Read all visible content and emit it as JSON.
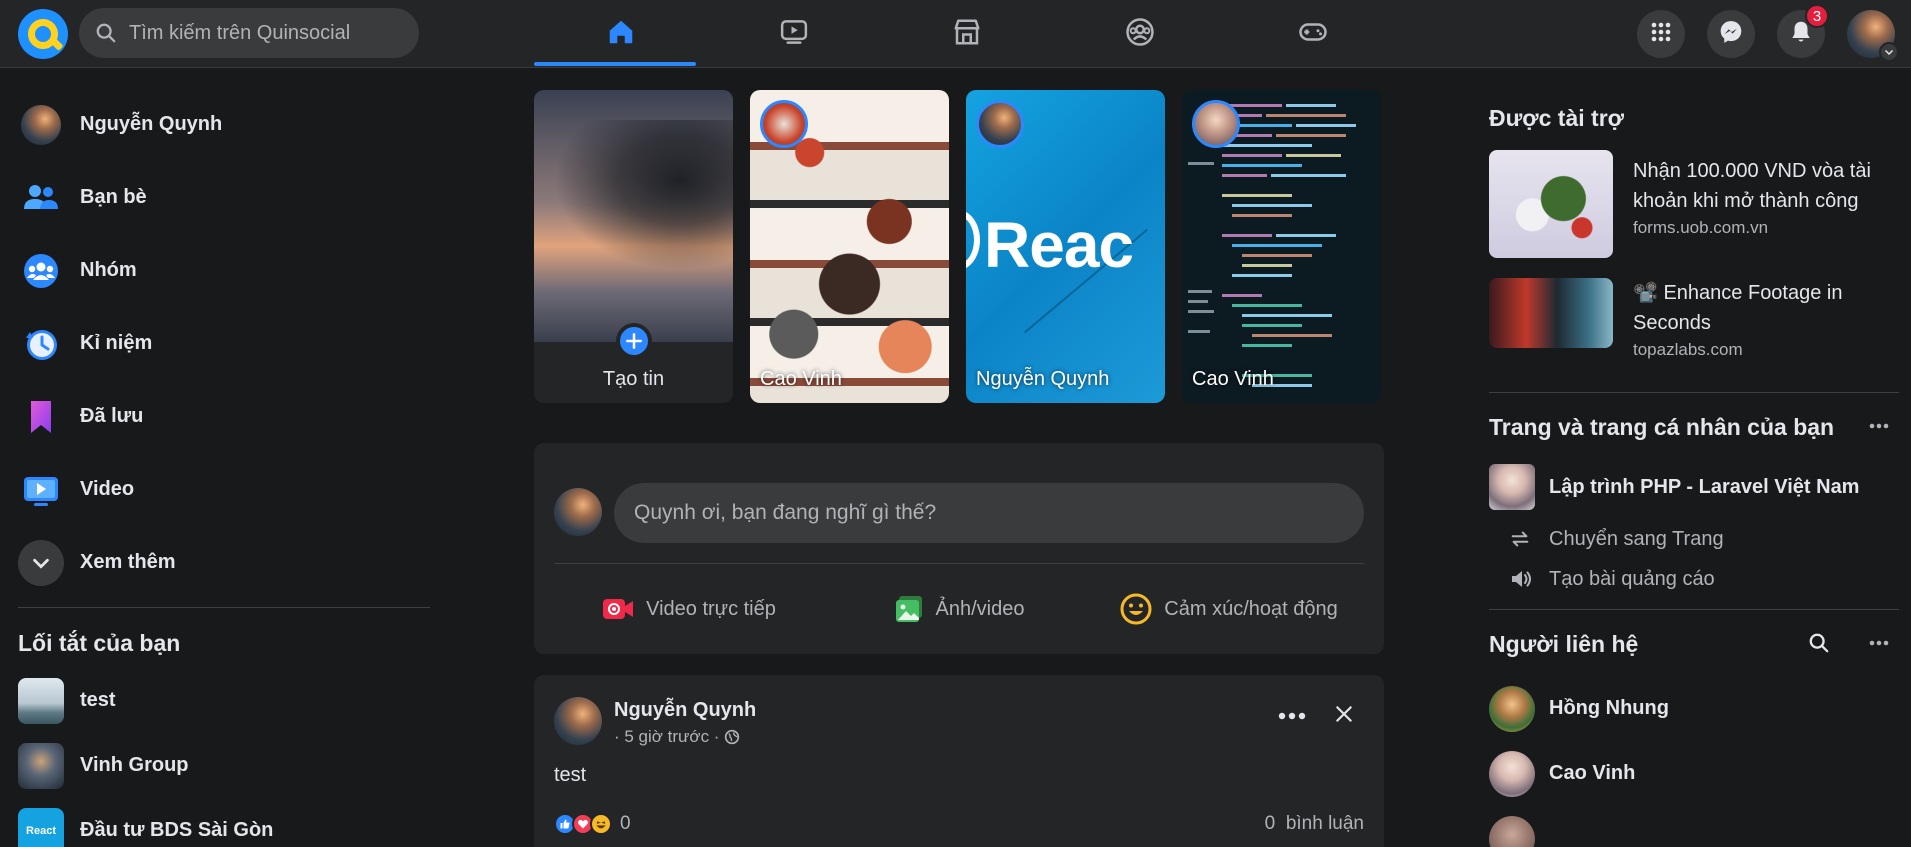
{
  "header": {
    "search_placeholder": "Tìm kiếm trên Quinsocial",
    "notification_count": "3",
    "nav_tabs": [
      "home",
      "watch",
      "marketplace",
      "groups",
      "gaming"
    ]
  },
  "left": {
    "profile_name": "Nguyễn Quynh",
    "items": [
      {
        "label": "Bạn bè",
        "icon": "friends-icon"
      },
      {
        "label": "Nhóm",
        "icon": "groups-icon"
      },
      {
        "label": "Kỉ niệm",
        "icon": "memories-icon"
      },
      {
        "label": "Đã lưu",
        "icon": "saved-icon"
      },
      {
        "label": "Video",
        "icon": "video-icon"
      },
      {
        "label": "Xem thêm",
        "icon": "chevron-down-icon"
      }
    ],
    "shortcuts_title": "Lối tắt của bạn",
    "shortcuts": [
      "test",
      "Vinh Group",
      "Đầu tư BDS Sài Gòn"
    ]
  },
  "stories": {
    "create_label": "Tạo tin",
    "items": [
      {
        "name": "Cao Vinh"
      },
      {
        "name": "Nguyễn Quynh",
        "image_text": "Reac"
      },
      {
        "name": "Cao Vinh"
      }
    ]
  },
  "composer": {
    "placeholder": "Quynh ơi, bạn đang nghĩ gì thế?",
    "actions": [
      "Video trực tiếp",
      "Ảnh/video",
      "Cảm xúc/hoạt động"
    ]
  },
  "post": {
    "author": "Nguyễn Quynh",
    "time": "· 5 giờ trước ·",
    "text": "test",
    "reactions_count": "0",
    "comments_count": "0",
    "comments_label": "bình luận"
  },
  "right": {
    "sponsored_title": "Được tài trợ",
    "ads": [
      {
        "title": "Nhận 100.000 VND vòa tài khoản khi mở thành công",
        "domain": "forms.uob.com.vn"
      },
      {
        "title": "📽️ Enhance Footage in Seconds",
        "domain": "topazlabs.com"
      }
    ],
    "pages_title": "Trang và trang cá nhân của bạn",
    "page_name": "Lập trình PHP - Laravel Việt Nam",
    "page_actions": [
      "Chuyển sang Trang",
      "Tạo bài quảng cáo"
    ],
    "contacts_title": "Người liên hệ",
    "contacts": [
      "Hồng Nhung",
      "Cao Vinh"
    ]
  },
  "colors": {
    "accent": "#2d88ff",
    "background": "#18191a",
    "surface": "#242526",
    "badge": "#e41e3f"
  }
}
